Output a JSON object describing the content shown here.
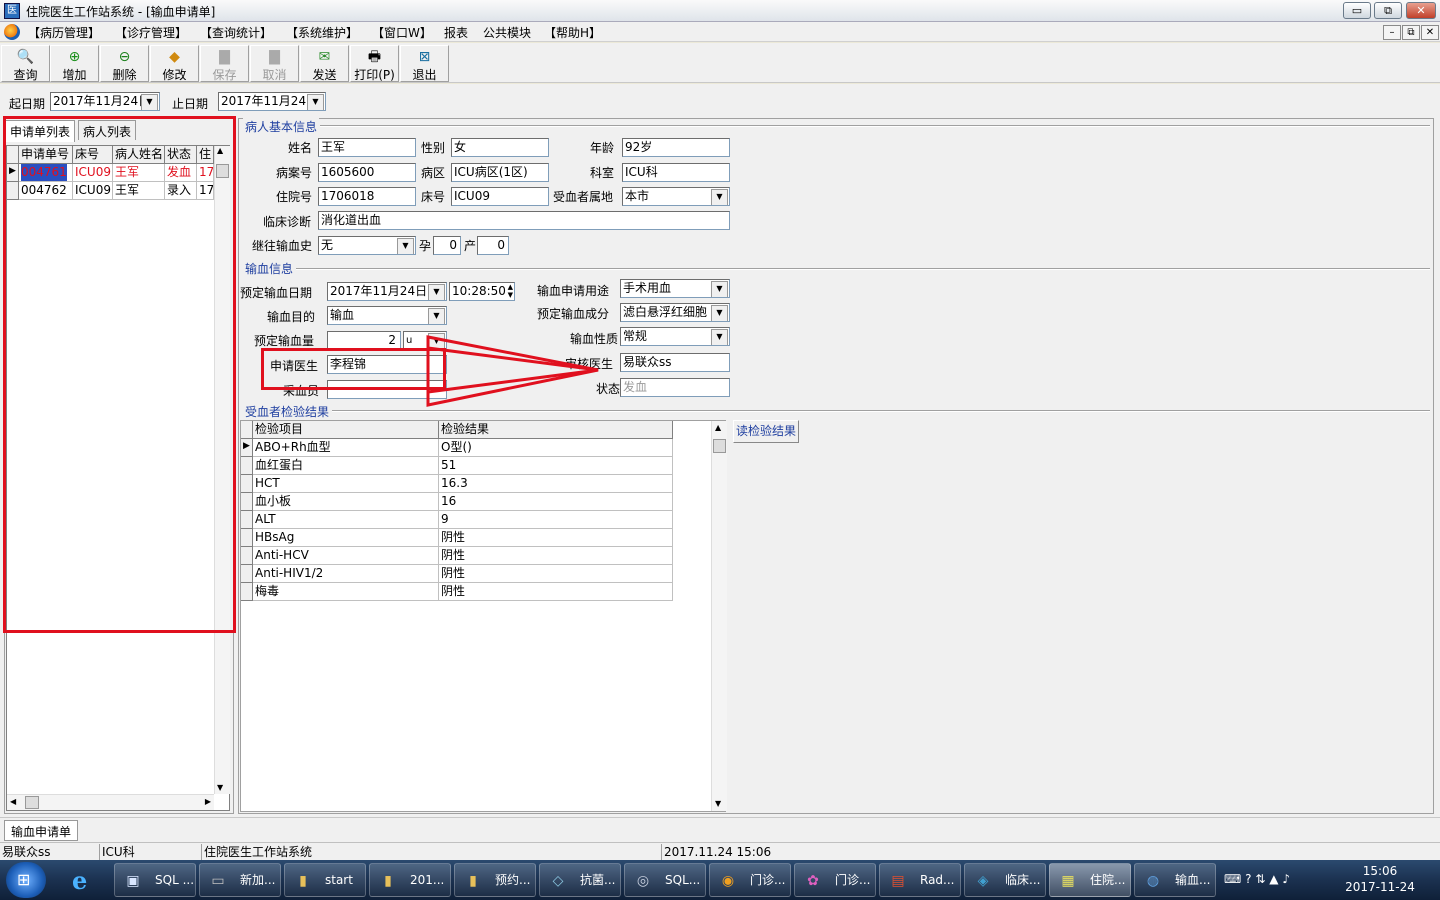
{
  "window": {
    "title": "住院医生工作站系统 - [输血申请单]",
    "min": "▭",
    "max": "⧉",
    "close": "✕"
  },
  "menu": [
    "【病历管理】",
    "【诊疗管理】",
    "【查询统计】",
    "【系统维护】",
    "【窗口W】",
    "报表",
    "公共模块",
    "【帮助H】"
  ],
  "mdi": [
    "–",
    "⧉",
    "✕"
  ],
  "toolbar": {
    "query": "查询",
    "add": "增加",
    "delete": "删除",
    "edit": "修改",
    "save": "保存",
    "cancel": "取消",
    "send": "发送",
    "print": "打印(P)",
    "exit": "退出"
  },
  "filter": {
    "start_label": "起日期",
    "start_value": "2017年11月24日",
    "end_label": "止日期",
    "end_value": "2017年11月24日"
  },
  "left_tabs": {
    "apply_list": "申请单列表",
    "patient_list": "病人列表"
  },
  "apply_grid": {
    "headers": [
      "申请单号",
      "床号",
      "病人姓名",
      "状态",
      "住"
    ],
    "rows": [
      [
        "004761",
        "ICU09",
        "王军",
        "发血",
        "17"
      ],
      [
        "004762",
        "ICU09",
        "王军",
        "录入",
        "17"
      ]
    ]
  },
  "patient_info": {
    "section": "病人基本信息",
    "name_label": "姓名",
    "name": "王军",
    "sex_label": "性别",
    "sex": "女",
    "age_label": "年龄",
    "age": "92岁",
    "record_label": "病案号",
    "record": "1605600",
    "ward_label": "病区",
    "ward": "ICU病区(1区)",
    "dept_label": "科室",
    "dept": "ICU科",
    "inpatient_label": "住院号",
    "inpatient": "1706018",
    "bed_label": "床号",
    "bed": "ICU09",
    "origin_label": "受血者属地",
    "origin": "本市",
    "diag_label": "临床诊断",
    "diag": "消化道出血",
    "history_label": "继往输血史",
    "history": "无",
    "preg_label": "孕",
    "preg": "0",
    "birth_label": "产",
    "birth": "0"
  },
  "transfusion_info": {
    "section": "输血信息",
    "date_label": "预定输血日期",
    "date": "2017年11月24日",
    "time": "10:28:50",
    "purpose_label": "输血申请用途",
    "purpose": "手术用血",
    "goal_label": "输血目的",
    "goal": "输血",
    "component_label": "预定输血成分",
    "component": "滤白悬浮红细胞",
    "amount_label": "预定输血量",
    "amount": "2",
    "unit": "u",
    "nature_label": "输血性质",
    "nature": "常规",
    "doctor_label": "申请医生",
    "doctor": "李程锦",
    "reviewer_label": "审核医生",
    "reviewer": "易联众ss",
    "collector_label": "采血员",
    "collector": "",
    "status_label": "状态",
    "status": "发血"
  },
  "test_results": {
    "section": "受血者检验结果",
    "headers": [
      "检验项目",
      "检验结果"
    ],
    "rows": [
      [
        "ABO+Rh血型",
        "O型()"
      ],
      [
        "血红蛋白",
        "51"
      ],
      [
        "HCT",
        "16.3"
      ],
      [
        "血小板",
        "16"
      ],
      [
        "ALT",
        "9"
      ],
      [
        "HBsAg",
        "阴性"
      ],
      [
        "Anti-HCV",
        "阴性"
      ],
      [
        "Anti-HIV1/2",
        "阴性"
      ],
      [
        "梅毒",
        "阴性"
      ]
    ],
    "read_button": "读检验结果"
  },
  "bottom_tab": "输血申请单",
  "status_bar": [
    "易联众ss",
    "ICU科",
    "住院医生工作站系统",
    "2017.11.24 15:06"
  ],
  "taskbar": {
    "apps": [
      "SQL ...",
      "新加...",
      "start",
      "201...",
      "预约...",
      "抗菌...",
      "SQL...",
      "门诊...",
      "门诊...",
      "Rad...",
      "临床...",
      "住院...",
      "输血..."
    ],
    "time": "15:06",
    "date": "2017-11-24"
  },
  "colors": {
    "red_highlight": "#e0101e",
    "selected_text": "#e0101e",
    "section_title": "#1f3fa0"
  }
}
